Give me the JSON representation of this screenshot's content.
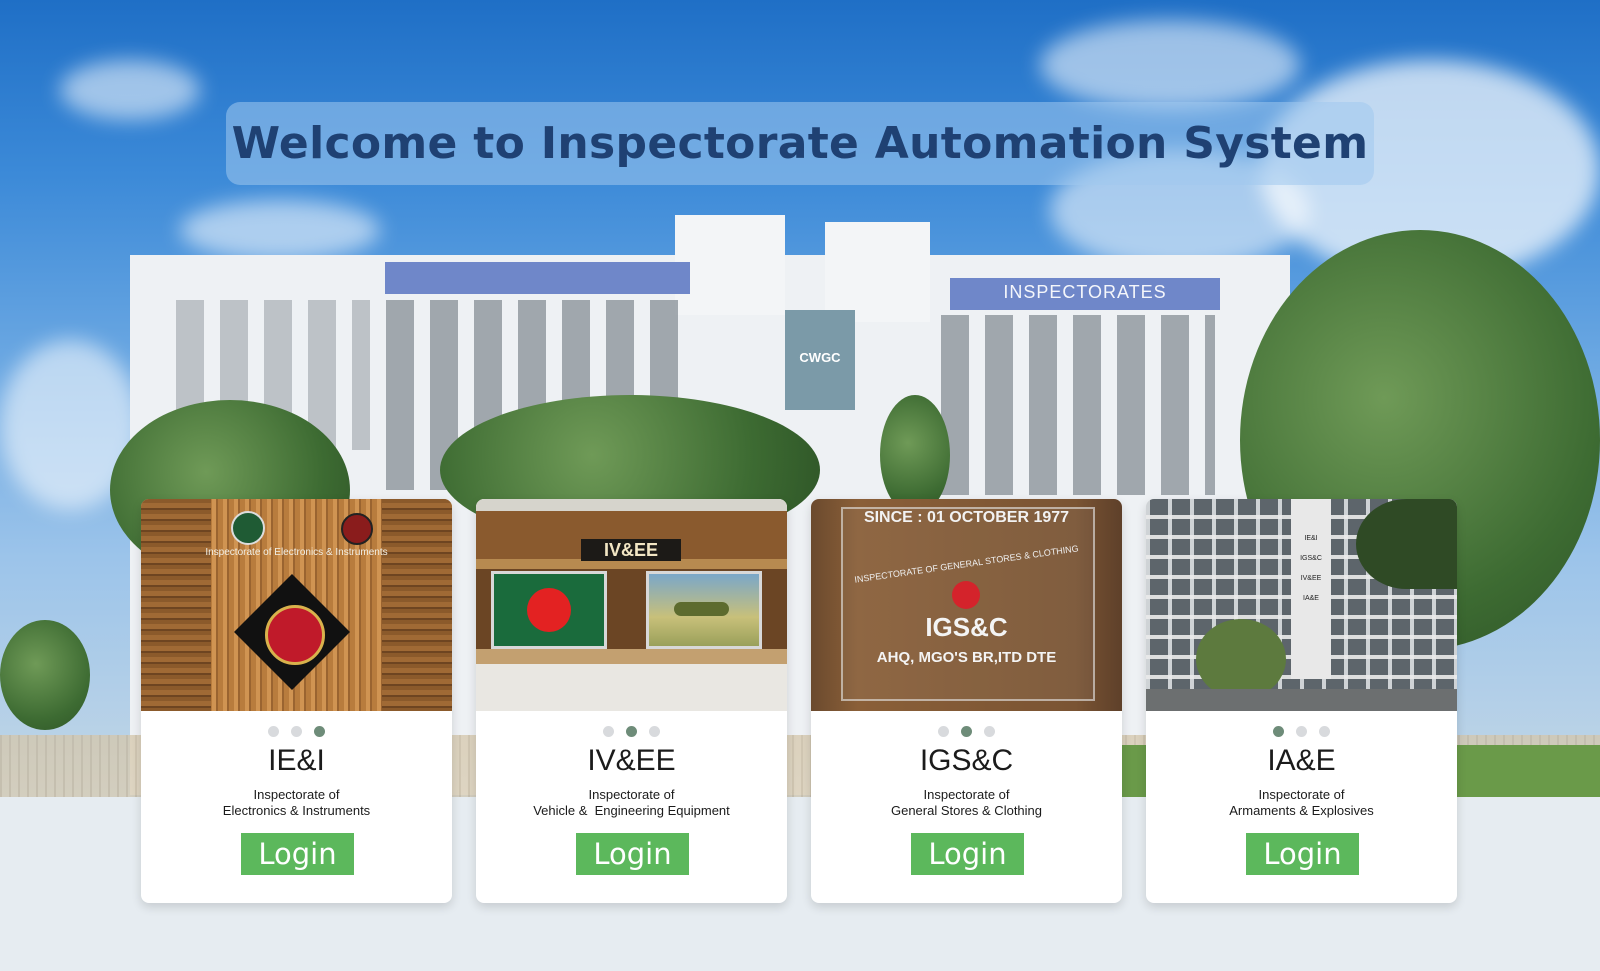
{
  "page": {
    "title": "Welcome to Inspectorate Automation System"
  },
  "background": {
    "building_sign": "INSPECTORATES",
    "mural_text": "CWGC"
  },
  "cards": [
    {
      "code": "IE&I",
      "desc_line1": "Inspectorate of",
      "desc_line2": "Electronics & Instruments",
      "login_label": "Login",
      "image_text": "Inspectorate of Electronics & Instruments",
      "active_dot": 2
    },
    {
      "code": "IV&EE",
      "desc_line1": "Inspectorate of",
      "desc_line2": "Vehicle &  Engineering Equipment",
      "login_label": "Login",
      "image_text": "IV&EE",
      "active_dot": 1
    },
    {
      "code": "IGS&C",
      "desc_line1": "Inspectorate of",
      "desc_line2": "General Stores & Clothing",
      "login_label": "Login",
      "image_text_1": "SINCE : 01 OCTOBER 1977",
      "image_text_2": "INSPECTORATE OF GENERAL STORES & CLOTHING",
      "image_text_3": "IGS&C",
      "image_text_4": "AHQ, MGO'S BR,ITD DTE",
      "active_dot": 1
    },
    {
      "code": "IA&E",
      "desc_line1": "Inspectorate of",
      "desc_line2": "Armaments & Explosives",
      "login_label": "Login",
      "image_text_1": "IE&I",
      "image_text_2": "IGS&C",
      "image_text_3": "IV&EE",
      "image_text_4": "IA&E",
      "active_dot": 0
    }
  ],
  "colors": {
    "login_button": "#5cb85c",
    "title_text": "#1f4173",
    "dot_active": "#6e8c79",
    "dot_inactive": "#d8dadd"
  }
}
